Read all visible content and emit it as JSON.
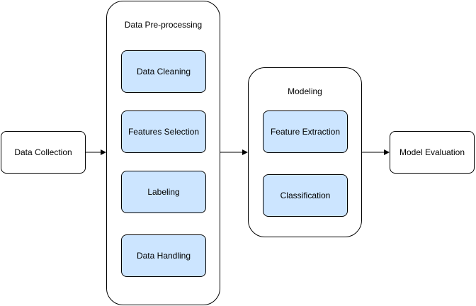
{
  "colors": {
    "stroke": "#000000",
    "step_fill": "#cce5ff",
    "box_fill": "#ffffff"
  },
  "nodes": {
    "data_collection": "Data Collection",
    "model_evaluation": "Model Evaluation"
  },
  "preprocessing": {
    "title": "Data Pre-processing",
    "steps": [
      "Data Cleaning",
      "Features Selection",
      "Labeling",
      "Data Handling"
    ]
  },
  "modeling": {
    "title": "Modeling",
    "steps": [
      "Feature Extraction",
      "Classification"
    ]
  }
}
